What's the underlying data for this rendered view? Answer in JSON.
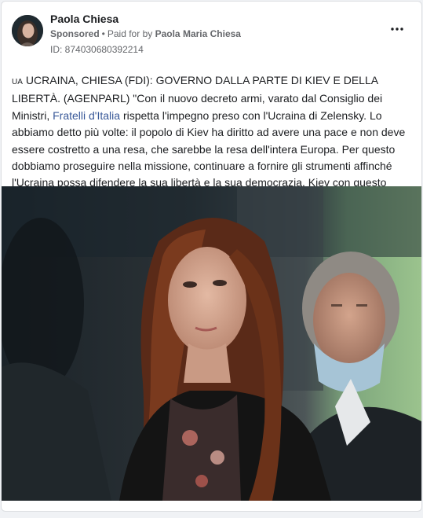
{
  "post": {
    "author_name": "Paola Chiesa",
    "sponsored_label": "Sponsored",
    "paid_for_prefix": "Paid for by",
    "paid_for_name": "Paola Maria Chiesa",
    "ad_id": "ID: 874030680392214",
    "more_icon": "more-options-icon",
    "flag_code": "UA",
    "text_part1": "UCRAINA, CHIESA (FDI): GOVERNO DALLA PARTE DI KIEV E DELLA LIBERTÀ. (AGENPARL) \"Con il nuovo decreto armi, varato dal Consiglio dei Ministri, ",
    "text_link": "Fratelli d'Italia",
    "text_part2": " rispetta l'impegno preso con l'Ucraina di Zelensky. Lo abbiamo detto più volte: il popolo di Kiev ha diritto ad avere una pace e non deve essere costretto a una resa, che sarebbe la resa dell'intera Europa. Per questo dobbiamo proseguire nella missione, continuare a fornire gli strumenti affinché l'Ucraina possa difendere la sua libertà e la sua democrazia. Kiev con questo governo non è sola e lo sta..."
  },
  "colors": {
    "link": "#385898",
    "text": "#1c1e21",
    "secondary": "#65676b"
  }
}
